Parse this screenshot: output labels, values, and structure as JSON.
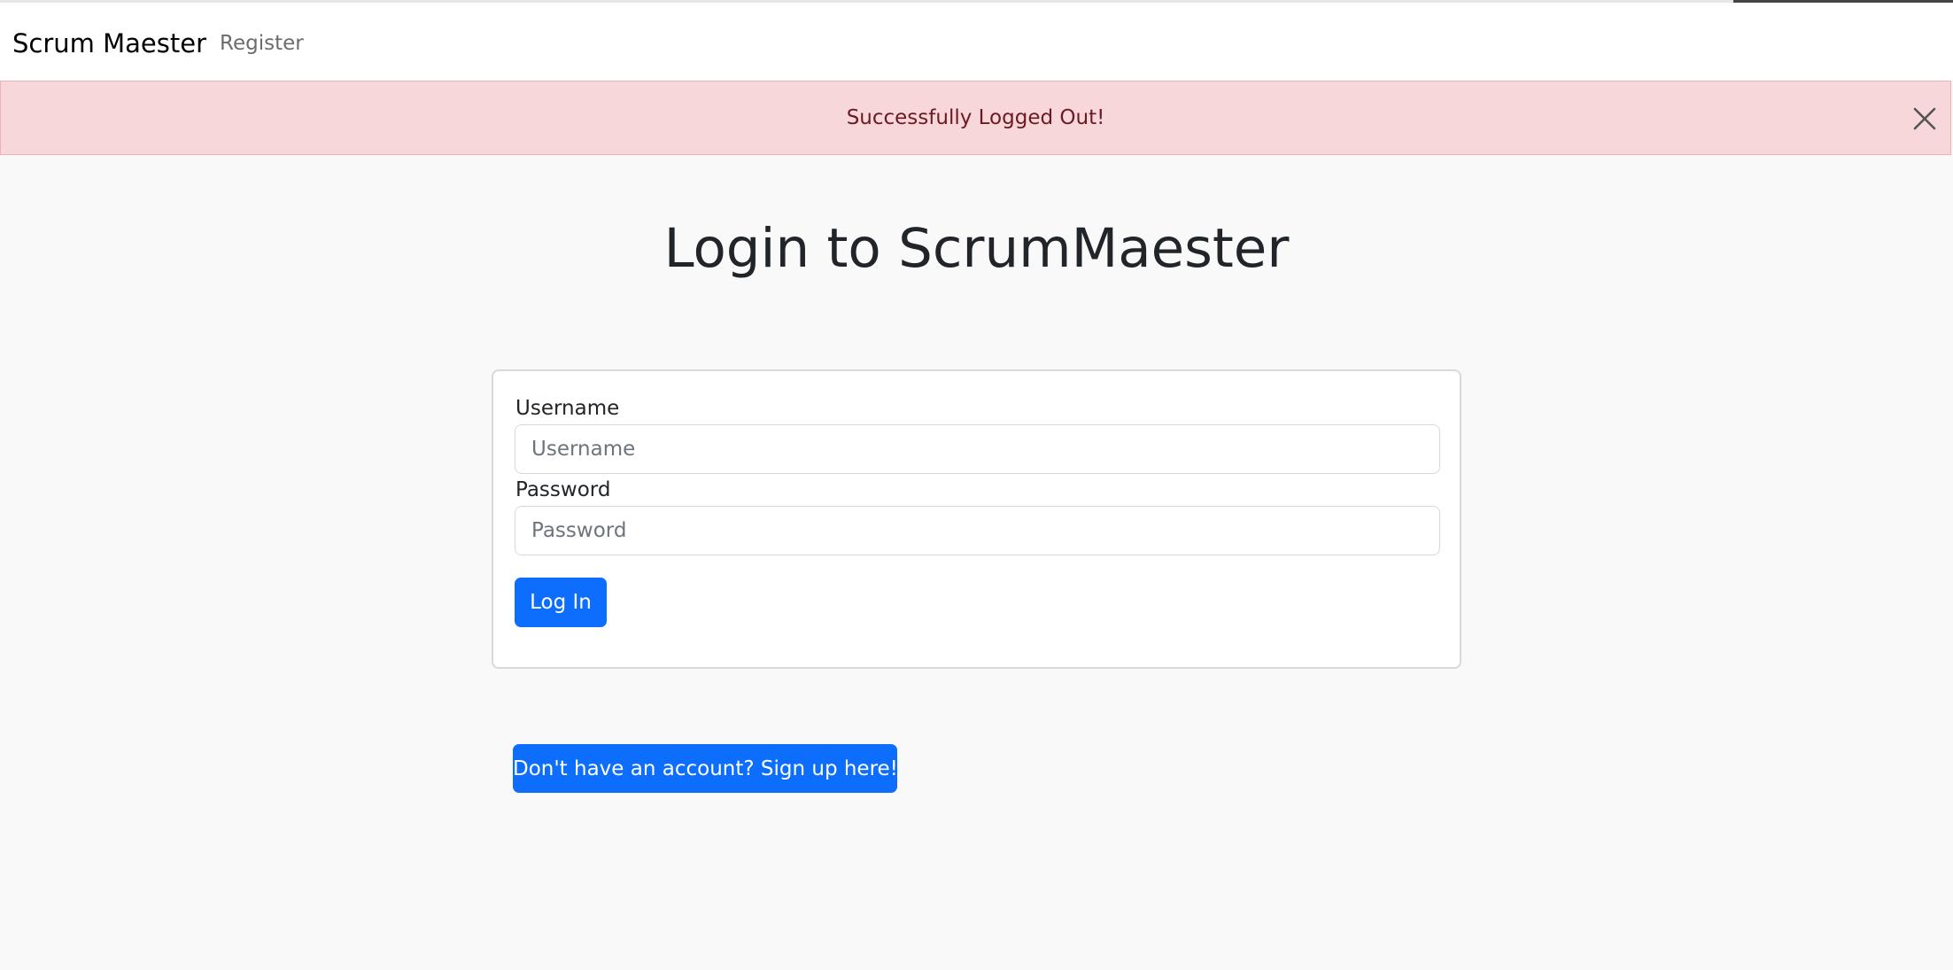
{
  "navbar": {
    "brand": "Scrum Maester",
    "links": [
      {
        "label": "Register"
      }
    ]
  },
  "alert": {
    "message": "Successfully Logged Out!",
    "close_icon": "close-icon",
    "background_color": "#f8d7da",
    "text_color": "#6b1a24"
  },
  "login": {
    "title": "Login to ScrumMaester",
    "username_label": "Username",
    "username_placeholder": "Username",
    "username_value": "",
    "password_label": "Password",
    "password_placeholder": "Password",
    "password_value": "",
    "submit_label": "Log In"
  },
  "signup": {
    "button_label": "Don't have an account? Sign up here!"
  },
  "colors": {
    "primary": "#0d6efd",
    "page_background": "#f9f9f9"
  }
}
